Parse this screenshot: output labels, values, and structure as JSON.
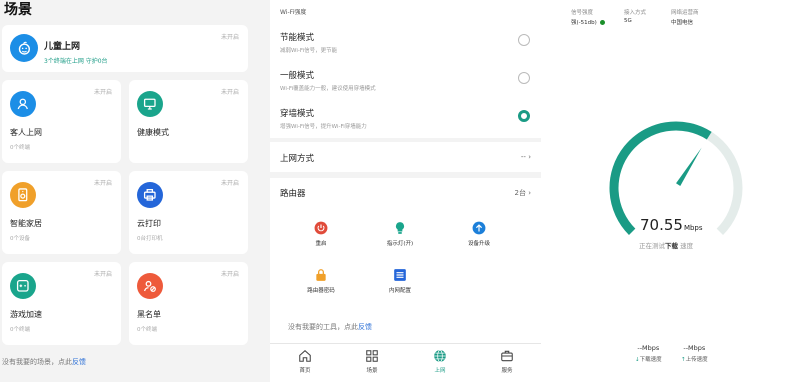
{
  "scenes": {
    "title": "场景",
    "kids": {
      "title": "儿童上网",
      "status": "未开启",
      "sub": "3个终端在上网 守护0台"
    },
    "cards": [
      {
        "label": "客人上网",
        "status": "未开启",
        "sub": "0个终端",
        "icon": "person-icon",
        "color": "#1c8ee6"
      },
      {
        "label": "健康模式",
        "status": "未开启",
        "sub": "",
        "icon": "monitor-icon",
        "color": "#1aa58c"
      },
      {
        "label": "智能家居",
        "status": "未开启",
        "sub": "0个设备",
        "icon": "speaker-icon",
        "color": "#f0a02a"
      },
      {
        "label": "云打印",
        "status": "未开启",
        "sub": "0台打印机",
        "icon": "printer-icon",
        "color": "#2466d9"
      },
      {
        "label": "游戏加速",
        "status": "未开启",
        "sub": "0个终端",
        "icon": "gamepad-icon",
        "color": "#1aa58c"
      },
      {
        "label": "黑名单",
        "status": "未开启",
        "sub": "0个终端",
        "icon": "block-icon",
        "color": "#ee5a3b"
      }
    ],
    "feedback_prefix": "没有我要的场景，点此",
    "feedback_link": "反馈"
  },
  "router": {
    "wifi_strength_label": "Wi-Fi强度",
    "modes": [
      {
        "title": "节能模式",
        "desc": "减弱Wi-Fi信号，更节能",
        "selected": false
      },
      {
        "title": "一般模式",
        "desc": "Wi-Fi覆盖能力一般，建议使用穿墙模式",
        "selected": false
      },
      {
        "title": "穿墙模式",
        "desc": "增强Wi-Fi信号，提升Wi-Fi穿墙能力",
        "selected": true
      }
    ],
    "internet_label": "上网方式",
    "internet_value": "--",
    "router_label": "路由器",
    "router_count": "2台",
    "tools": [
      {
        "label": "重启",
        "icon": "power-icon",
        "color": "#e04b3a"
      },
      {
        "label": "指示灯(开)",
        "icon": "bulb-icon",
        "color": "#1aa58c"
      },
      {
        "label": "设备升级",
        "icon": "upgrade-icon",
        "color": "#1c7fd9"
      },
      {
        "label": "路由器密码",
        "icon": "lock-icon",
        "color": "#f0a02a"
      },
      {
        "label": "内网配置",
        "icon": "list-icon",
        "color": "#2466d9"
      }
    ],
    "tools_feedback_prefix": "没有我要的工具，点此",
    "tools_feedback_link": "反馈",
    "nav": [
      {
        "label": "首页",
        "icon": "home-icon"
      },
      {
        "label": "场景",
        "icon": "grid-icon"
      },
      {
        "label": "上网",
        "icon": "globe-icon",
        "active": true
      },
      {
        "label": "服务",
        "icon": "briefcase-icon"
      }
    ]
  },
  "speedtest": {
    "signal_label": "信号强度",
    "signal_value": "强(-51db)",
    "access_label": "接入方式",
    "access_value": "5G",
    "isp_label": "网络运营商",
    "isp_value": "中国电信",
    "speed_value": "70.55",
    "speed_unit": "Mbps",
    "status_prefix": "正在测试",
    "status_bold": "下载",
    "status_suffix": "速度",
    "download_value": "--Mbps",
    "download_label": "下载速度",
    "upload_value": "--Mbps",
    "upload_label": "上传速度",
    "gauge_progress": 0.62,
    "accent": "#1a9b85"
  }
}
